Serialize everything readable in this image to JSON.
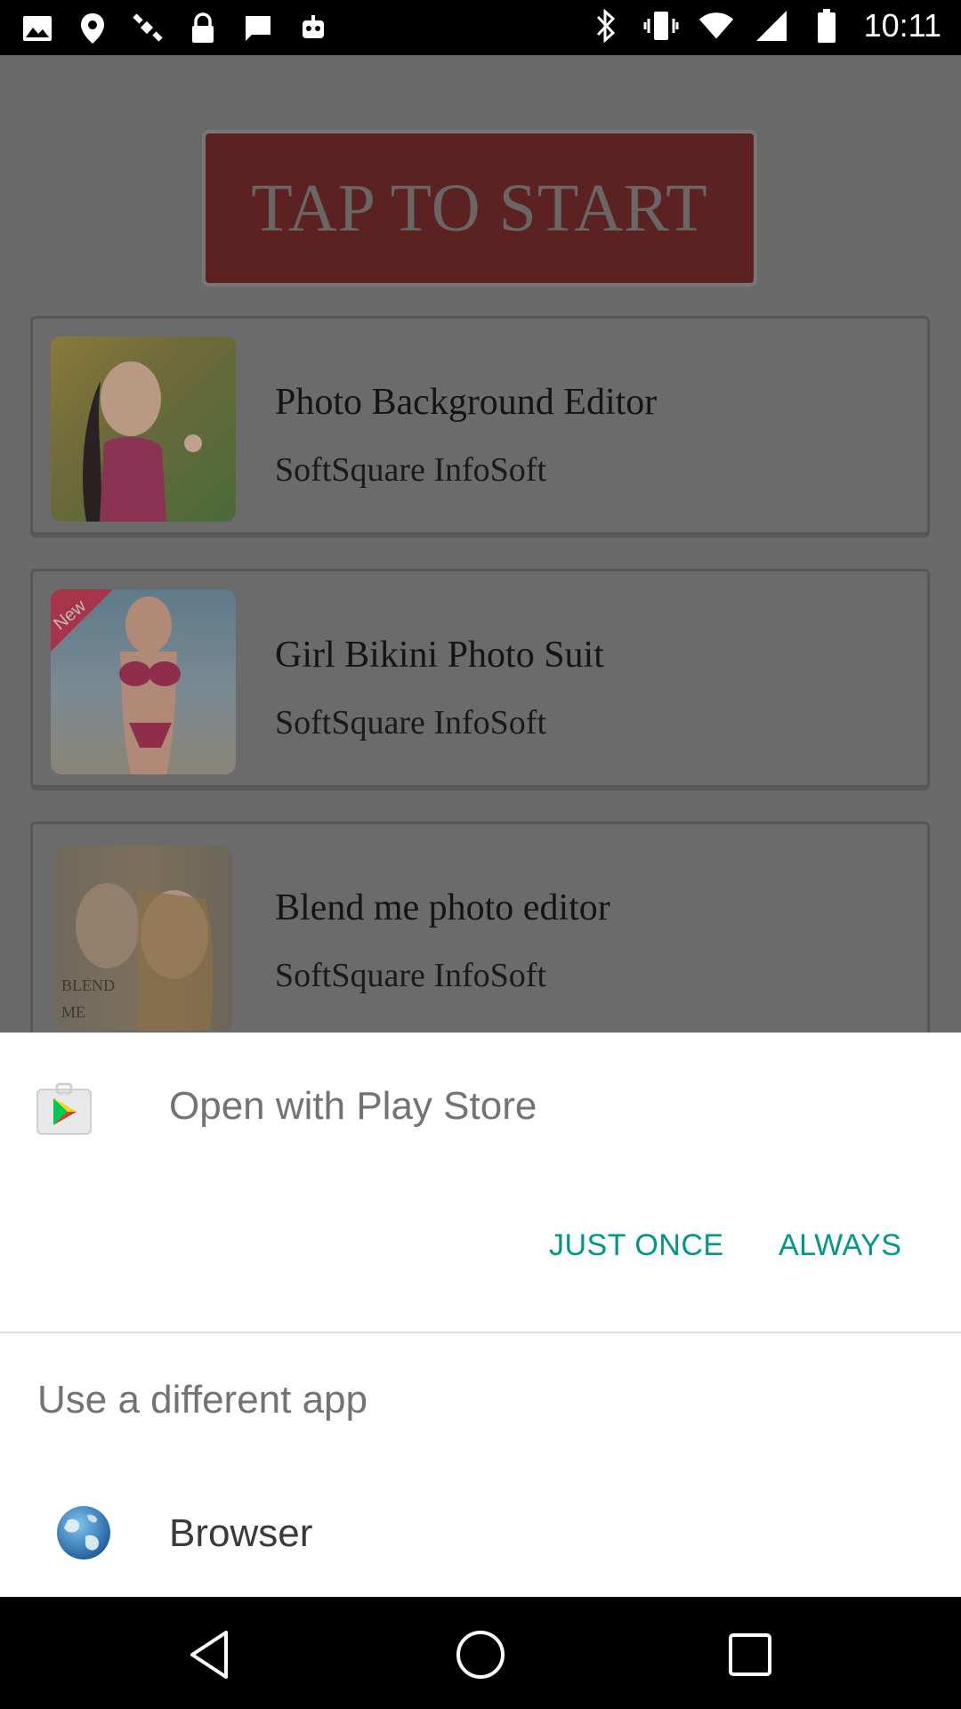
{
  "status_bar": {
    "time": "10:11",
    "left_icons": [
      "image-icon",
      "location-icon",
      "satellite-icon",
      "lock-icon",
      "message-icon",
      "robot-icon"
    ],
    "right_icons": [
      "bluetooth-icon",
      "vibrate-icon",
      "wifi-icon",
      "signal-icon",
      "battery-icon"
    ]
  },
  "app": {
    "start_button_label": "TAP TO START",
    "cards": [
      {
        "title": "Photo Background Editor",
        "subtitle": "SoftSquare InfoSoft"
      },
      {
        "title": "Girl Bikini Photo Suit",
        "subtitle": "SoftSquare InfoSoft",
        "badge": "New"
      },
      {
        "title": "Blend me photo editor",
        "subtitle": "SoftSquare InfoSoft",
        "thumb_text": "BLEND ME"
      }
    ]
  },
  "dialog": {
    "title": "Open with Play Store",
    "just_once_label": "JUST ONCE",
    "always_label": "ALWAYS",
    "different_app_label": "Use a different app",
    "apps": [
      {
        "label": "Browser",
        "icon": "globe-icon"
      }
    ],
    "accent_color": "#009688"
  },
  "nav_bar": {
    "buttons": [
      "back-icon",
      "home-icon",
      "recents-icon"
    ]
  }
}
